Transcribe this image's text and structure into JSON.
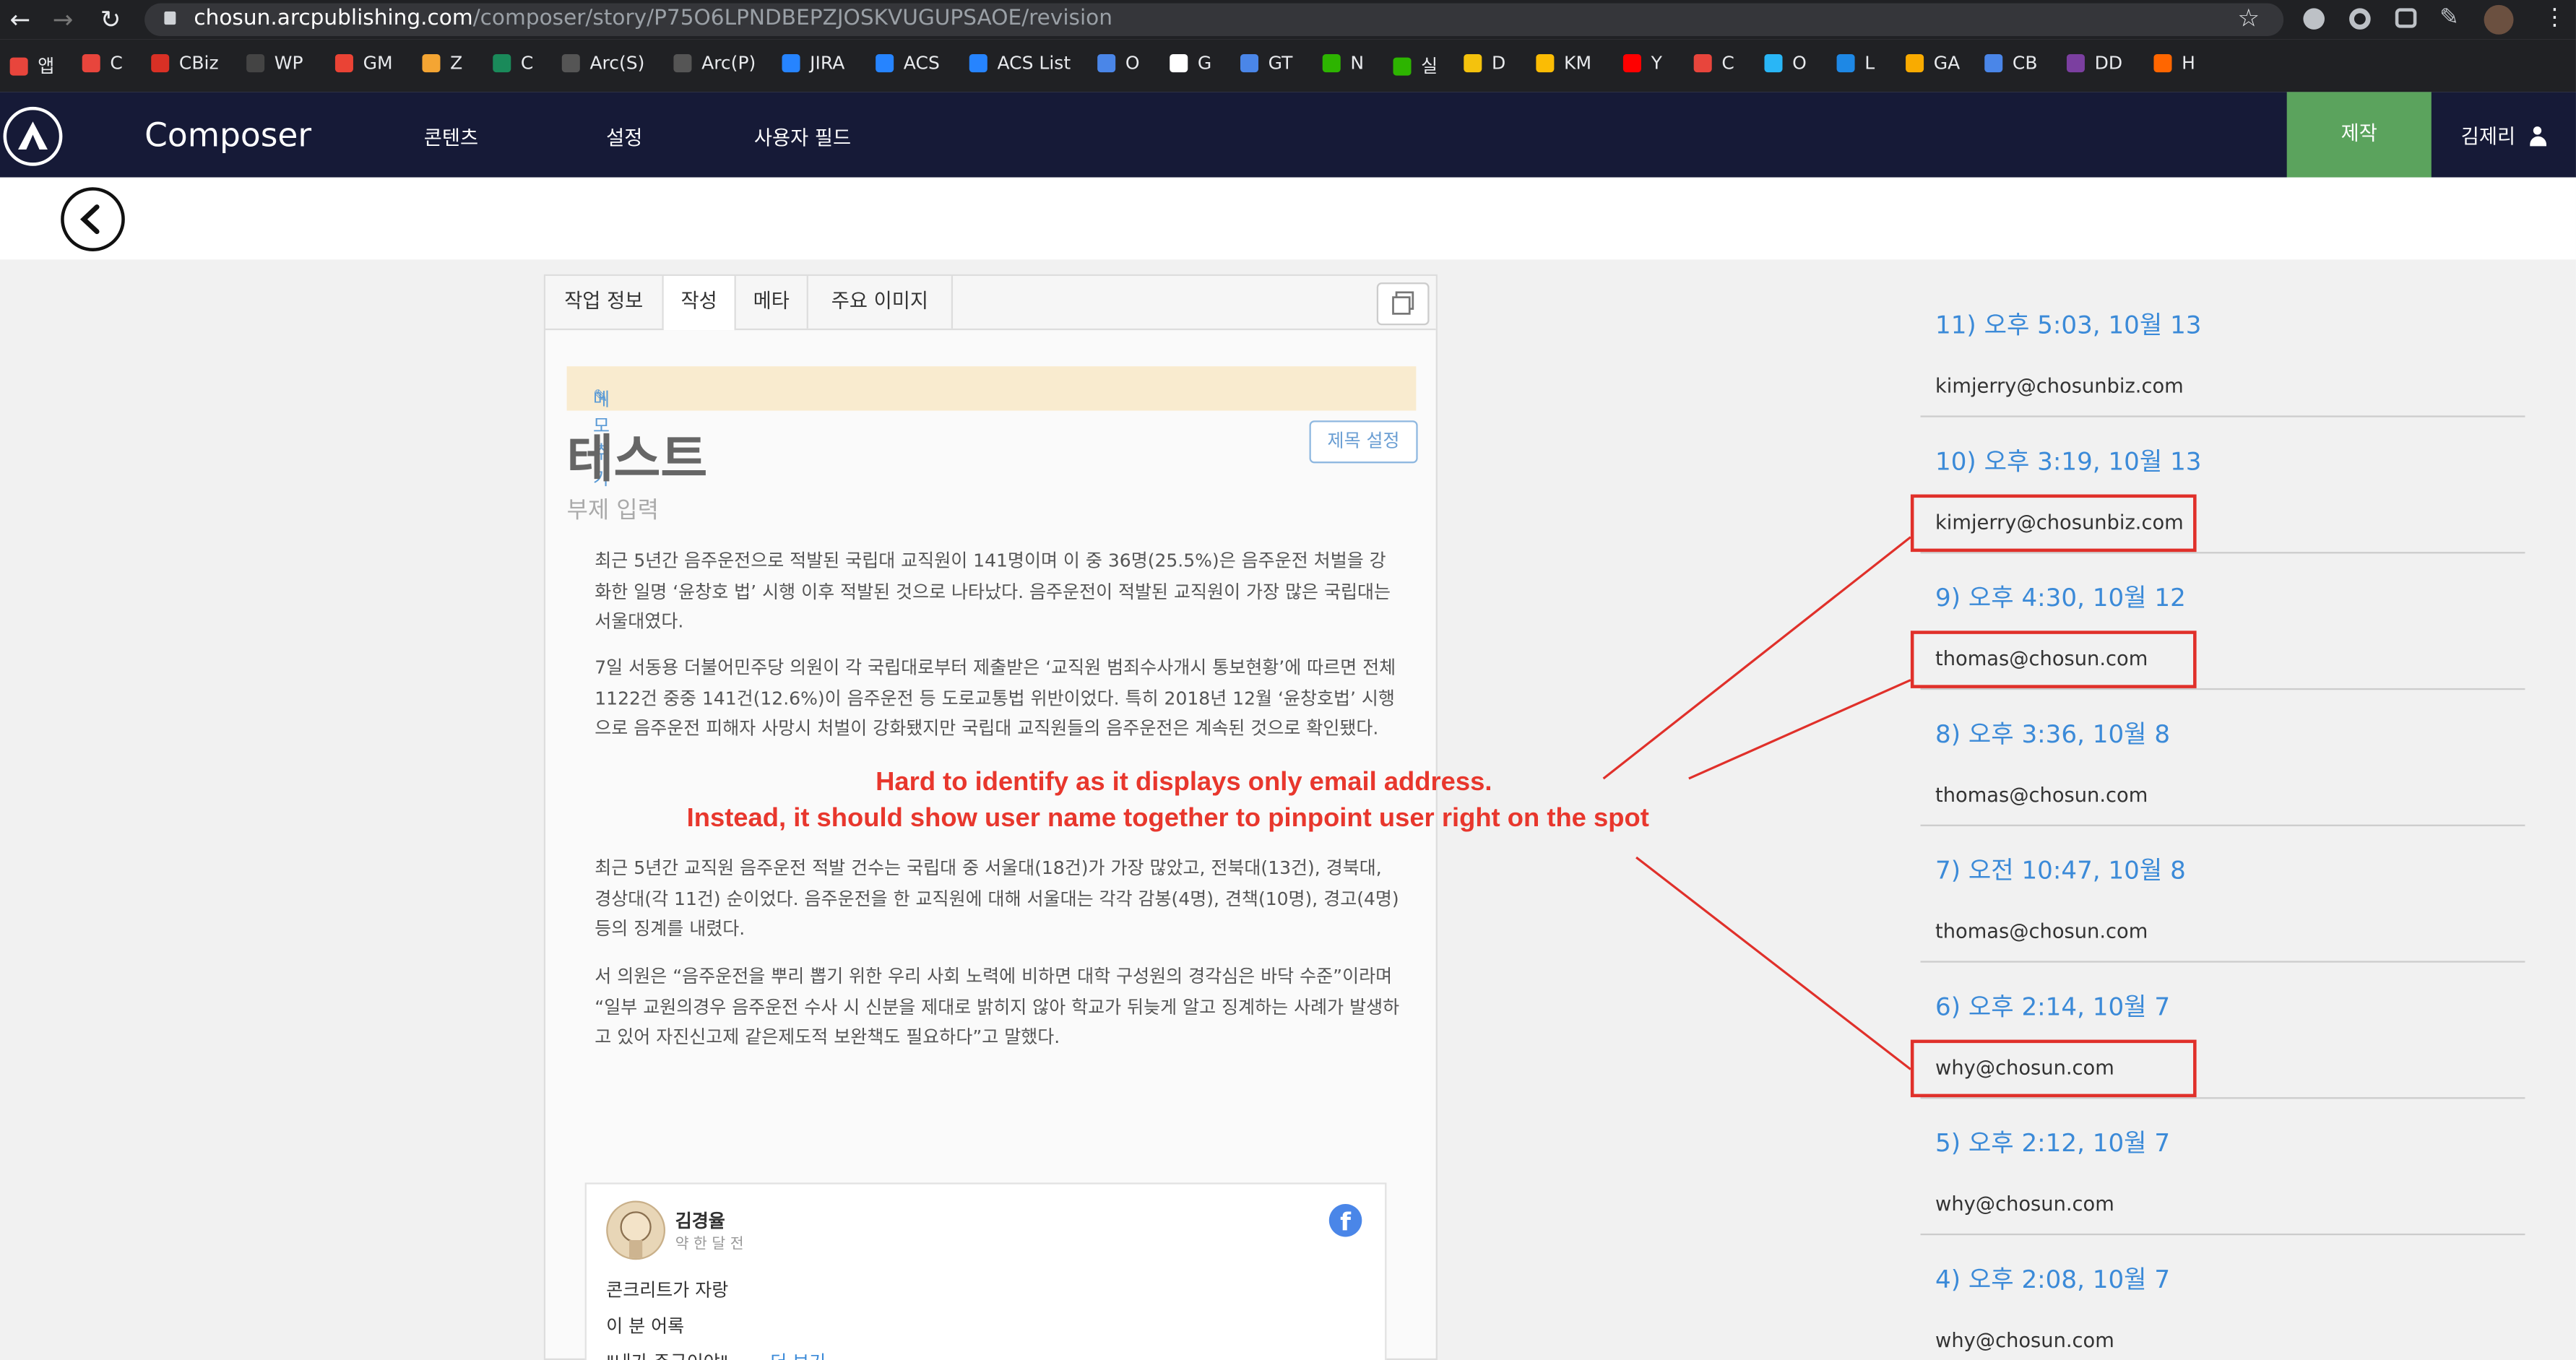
{
  "browser": {
    "url_domain": "chosun.arcpublishing.com",
    "url_path": "/composer/story/P75O6LPNDBEPZJOSKVUGUPSAOE/revision",
    "bookmarks": [
      {
        "label": "앱",
        "color": "#e8453c"
      },
      {
        "label": "C",
        "color": "#e8453c"
      },
      {
        "label": "CBiz",
        "color": "#d93025"
      },
      {
        "label": "WP",
        "color": "#444444"
      },
      {
        "label": "GM",
        "color": "#ea4335"
      },
      {
        "label": "Z",
        "color": "#f4a533"
      },
      {
        "label": "C",
        "color": "#1a8a5a"
      },
      {
        "label": "Arc(S)",
        "color": "#555555"
      },
      {
        "label": "Arc(P)",
        "color": "#555555"
      },
      {
        "label": "JIRA",
        "color": "#2684ff"
      },
      {
        "label": "ACS",
        "color": "#2684ff"
      },
      {
        "label": "ACS List",
        "color": "#2684ff"
      },
      {
        "label": "O",
        "color": "#4a86e8"
      },
      {
        "label": "G",
        "color": "#ffffff"
      },
      {
        "label": "GT",
        "color": "#4a86e8"
      },
      {
        "label": "N",
        "color": "#2db400"
      },
      {
        "label": "실",
        "color": "#2db400"
      },
      {
        "label": "D",
        "color": "#f4c20d"
      },
      {
        "label": "KM",
        "color": "#fbbc04"
      },
      {
        "label": "Y",
        "color": "#ff0000"
      },
      {
        "label": "C",
        "color": "#e8453c"
      },
      {
        "label": "O",
        "color": "#29b6f6"
      },
      {
        "label": "L",
        "color": "#1e88e5"
      },
      {
        "label": "GA",
        "color": "#f9ab00"
      },
      {
        "label": "CB",
        "color": "#4a86e8"
      },
      {
        "label": "DD",
        "color": "#7b3fa0"
      },
      {
        "label": "H",
        "color": "#ff6600"
      }
    ]
  },
  "app": {
    "name": "Composer",
    "nav": [
      "콘텐츠",
      "설정",
      "사용자 필드"
    ],
    "produce_button": "제작",
    "user_name": "김제리"
  },
  "editor": {
    "tabs": [
      "작업 정보",
      "작성",
      "메타",
      "주요 이미지"
    ],
    "active_tab": "작성",
    "memo_label": "메모 추가",
    "title": "테스트",
    "title_button": "제목 설정",
    "subtitle_placeholder": "부제 입력",
    "paragraphs": [
      "최근 5년간 음주운전으로 적발된 국립대 교직원이 141명이며 이 중 36명(25.5%)은 음주운전 처벌을 강화한 일명 ‘윤창호 법’ 시행 이후 적발된 것으로 나타났다. 음주운전이 적발된 교직원이 가장 많은 국립대는 서울대였다.",
      "7일 서동용 더불어민주당 의원이 각 국립대로부터 제출받은 ‘교직원 범죄수사개시 통보현황’에 따르면 전체 1122건 중중 141건(12.6%)이 음주운전 등 도로교통법 위반이었다. 특히 2018년 12월 ‘윤창호법’ 시행으로 음주운전 피해자 사망시 처벌이 강화됐지만 국립대 교직원들의 음주운전은 계속된 것으로 확인됐다.",
      "최근 5년간 교직원 음주운전 적발 건수는 국립대 중 서울대(18건)가 가장 많았고, 전북대(13건), 경북대, 경상대(각 11건) 순이었다. 음주운전을 한 교직원에 대해 서울대는 각각 감봉(4명), 견책(10명), 경고(4명) 등의 징계를 내렸다.",
      "서 의원은 “음주운전을 뿌리 뽑기 위한 우리 사회 노력에 비하면 대학 구성원의 경각심은 바닥 수준”이라며 “일부 교원의경우 음주운전 수사 시 신분을 제대로 밝히지 않아 학교가 뒤늦게 알고 징계하는 사례가 발생하고 있어 자진신고제 같은제도적 보완책도 필요하다”고 말했다."
    ],
    "facebook_embed": {
      "author": "김경율",
      "time": "약 한 달 전",
      "lines": [
        "콘크리트가 자랑",
        "이 분 어록",
        "\"내가 주군이야\""
      ],
      "more_link": "... 더 보기"
    }
  },
  "revisions": [
    {
      "title": "11) 오후 5:03, 10월 13",
      "email": "kimjerry@chosunbiz.com",
      "highlighted": false
    },
    {
      "title": "10) 오후 3:19, 10월 13",
      "email": "kimjerry@chosunbiz.com",
      "highlighted": true
    },
    {
      "title": "9) 오후 4:30, 10월 12",
      "email": "thomas@chosun.com",
      "highlighted": true
    },
    {
      "title": "8) 오후 3:36, 10월 8",
      "email": "thomas@chosun.com",
      "highlighted": false
    },
    {
      "title": "7) 오전 10:47, 10월 8",
      "email": "thomas@chosun.com",
      "highlighted": false
    },
    {
      "title": "6) 오후 2:14, 10월 7",
      "email": "why@chosun.com",
      "highlighted": true
    },
    {
      "title": "5) 오후 2:12, 10월 7",
      "email": "why@chosun.com",
      "highlighted": false
    },
    {
      "title": "4) 오후 2:08, 10월 7",
      "email": "why@chosun.com",
      "highlighted": false
    }
  ],
  "annotation": {
    "line1": "Hard to identify as it displays only email address.",
    "line2": "Instead, it should show user name together to pinpoint user right on the spot",
    "color": "#e8372d"
  },
  "colors": {
    "header": "#161a37",
    "produce": "#5ba35d",
    "link": "#3b8ad8",
    "memo_bg": "#f9ebcf"
  }
}
